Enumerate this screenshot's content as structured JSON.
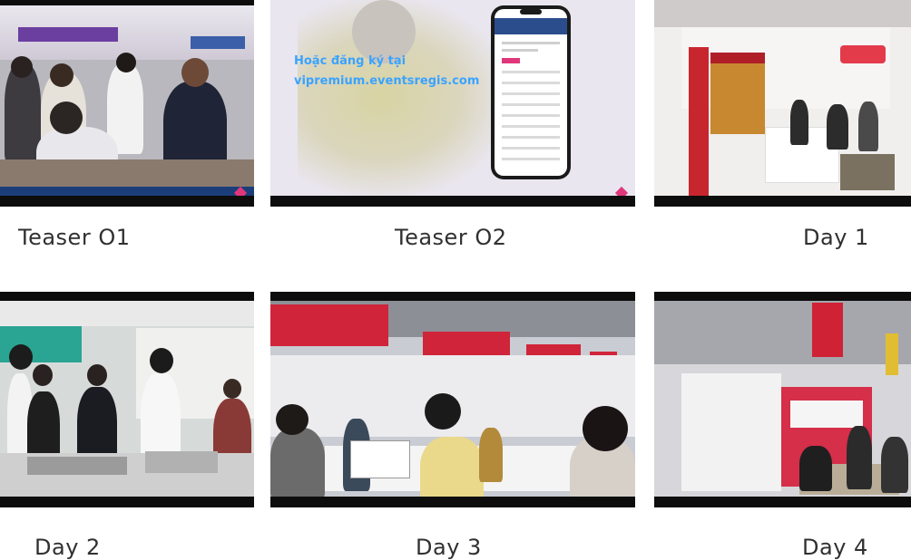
{
  "gallery": {
    "items": [
      {
        "caption": "Teaser O1"
      },
      {
        "caption": "Teaser O2",
        "overlay_text_line1": "Hoặc đăng ký tại",
        "overlay_text_line2": "vipremium.eventsregis.com"
      },
      {
        "caption": "Day 1"
      },
      {
        "caption": "Day 2"
      },
      {
        "caption": "Day 3"
      },
      {
        "caption": "Day 4"
      }
    ]
  },
  "colors": {
    "brand_red": "#d0243a",
    "brand_pink": "#e0377a",
    "overlay_text": "#3aa3ff"
  }
}
